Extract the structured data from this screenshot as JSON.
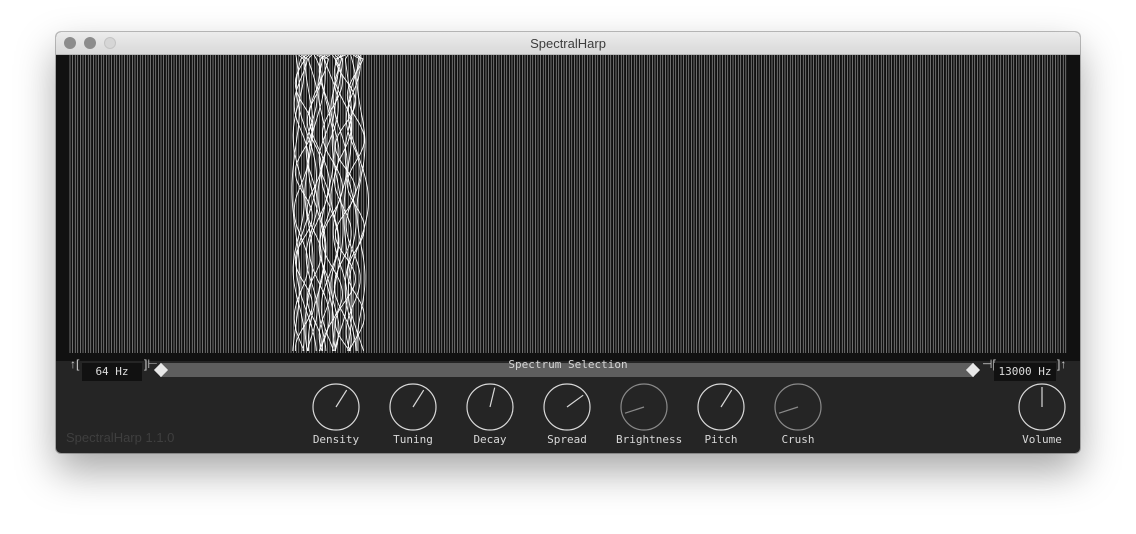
{
  "window": {
    "title": "SpectralHarp"
  },
  "spectrum": {
    "low_label": "64 Hz",
    "high_label": "13000 Hz",
    "selection_label": "Spectrum Selection",
    "range_low_fraction": 0.0,
    "range_high_fraction": 1.0
  },
  "knobs": [
    {
      "label": "Density",
      "value": 0.62,
      "enabled": true
    },
    {
      "label": "Tuning",
      "value": 0.62,
      "enabled": true
    },
    {
      "label": "Decay",
      "value": 0.55,
      "enabled": true
    },
    {
      "label": "Spread",
      "value": 0.7,
      "enabled": true
    },
    {
      "label": "Brightness",
      "value": 0.1,
      "enabled": false
    },
    {
      "label": "Pitch",
      "value": 0.62,
      "enabled": true
    },
    {
      "label": "Crush",
      "value": 0.1,
      "enabled": false
    },
    {
      "label": "Volume",
      "value": 0.5,
      "enabled": true
    }
  ],
  "footer": {
    "version": "SpectralHarp 1.1.0"
  },
  "colors": {
    "panel": "#252525",
    "display": "#111111",
    "string": "#d9d9d9",
    "knob_active": "#d8d8d8",
    "knob_inactive": "#8a8a8a"
  }
}
